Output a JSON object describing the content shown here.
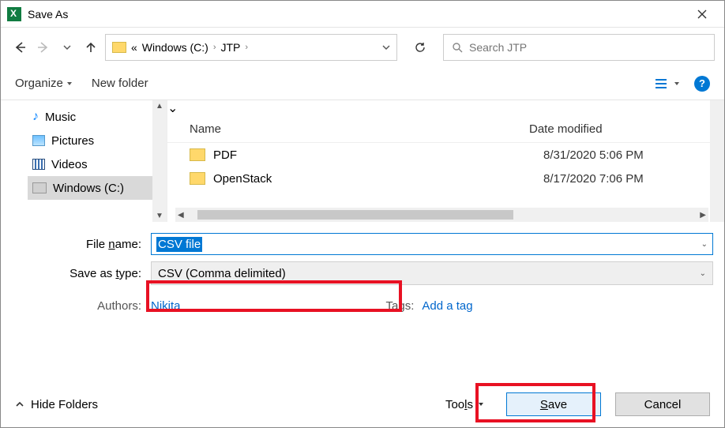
{
  "title": "Save As",
  "breadcrumb": {
    "ellipsis": "«",
    "part1": "Windows (C:)",
    "part2": "JTP"
  },
  "search": {
    "placeholder": "Search JTP"
  },
  "toolbar": {
    "organize": "Organize",
    "newfolder": "New folder"
  },
  "sidebar": {
    "items": [
      {
        "label": "Music"
      },
      {
        "label": "Pictures"
      },
      {
        "label": "Videos"
      },
      {
        "label": "Windows (C:)"
      }
    ]
  },
  "columns": {
    "name": "Name",
    "date": "Date modified"
  },
  "files": [
    {
      "name": "PDF",
      "date": "8/31/2020 5:06 PM"
    },
    {
      "name": "OpenStack",
      "date": "8/17/2020 7:06 PM"
    }
  ],
  "form": {
    "filename_label_pre": "File ",
    "filename_label_u": "n",
    "filename_label_post": "ame:",
    "filename_value": "CSV file",
    "type_label_pre": "Save as ",
    "type_label_u": "t",
    "type_label_post": "ype:",
    "type_value": "CSV (Comma delimited)",
    "authors_label": "Authors:",
    "authors_value": "Nikita",
    "tags_label": "Tags:",
    "tags_value": "Add a tag"
  },
  "footer": {
    "hide": "Hide Folders",
    "tools_pre": "Too",
    "tools_u": "l",
    "tools_post": "s",
    "save_u": "S",
    "save_post": "ave",
    "cancel": "Cancel"
  }
}
